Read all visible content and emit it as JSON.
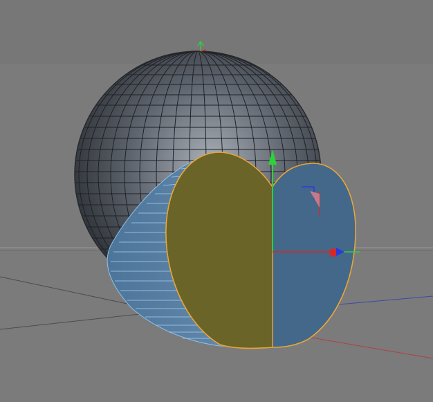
{
  "viewport": {
    "view_type": "perspective-3d-viewport",
    "background_top": "#7b7b7b",
    "background_bottom": "#7d7d7d",
    "horizon_band": "#8a8a8a"
  },
  "scene": {
    "sphere": {
      "object": "sphere-primitive",
      "fill_center": "#9aa0a8",
      "fill_edge": "#2d3137",
      "wire_color": "#1e2024",
      "selected": false
    },
    "split_object": {
      "object": "heart-extrude",
      "selected": true,
      "selection_outline": "#e7a63a",
      "left_face_color": "#6b6428",
      "right_face_color": "#44688a",
      "side_color": "#5a7e9e",
      "side_lines": "#8fc0ec"
    },
    "axes": {
      "x_color": "#d62828",
      "y_color": "#2fd13a",
      "z_color": "#2a3adb"
    }
  },
  "icons": {
    "move_gizmo": "move-gizmo-icon",
    "world_axis": "world-axis-icon",
    "object_axis": "object-axis-icon"
  }
}
